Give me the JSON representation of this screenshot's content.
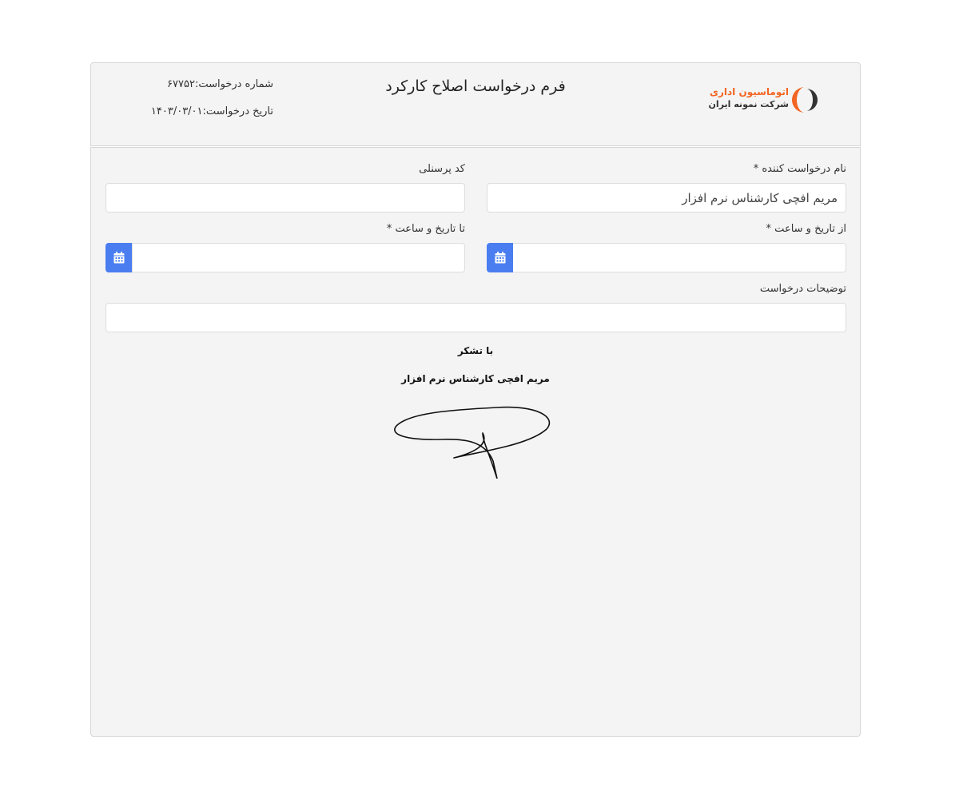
{
  "header": {
    "title": "فرم درخواست اصلاح کارکرد",
    "request_number": "شماره درخواست:۶۷۷۵۲",
    "request_date": "تاریخ درخواست:۱۴۰۳/۰۳/۰۱",
    "logo": {
      "line1": "اتوماسیون اداری",
      "line2": "شرکت نمونه ایران",
      "accent_color": "#f26522",
      "icon": "company-logo-icon"
    }
  },
  "form": {
    "requester_name": {
      "label": "نام درخواست کننده *",
      "value": "مریم افچی کارشناس نرم افزار"
    },
    "personnel_code": {
      "label": "کد پرسنلی",
      "value": ""
    },
    "from_datetime": {
      "label": "از تاریخ و ساعت *",
      "value": "",
      "icon": "calendar-icon"
    },
    "to_datetime": {
      "label": "تا تاریخ و ساعت *",
      "value": "",
      "icon": "calendar-icon"
    },
    "description": {
      "label": "توضیحات درخواست",
      "value": ""
    },
    "calendar_button_color": "#4a7ef0"
  },
  "footer": {
    "thanks": "با تشکر",
    "signer": "مریم افچی کارشناس نرم افزار",
    "signature_icon": "signature-image"
  }
}
